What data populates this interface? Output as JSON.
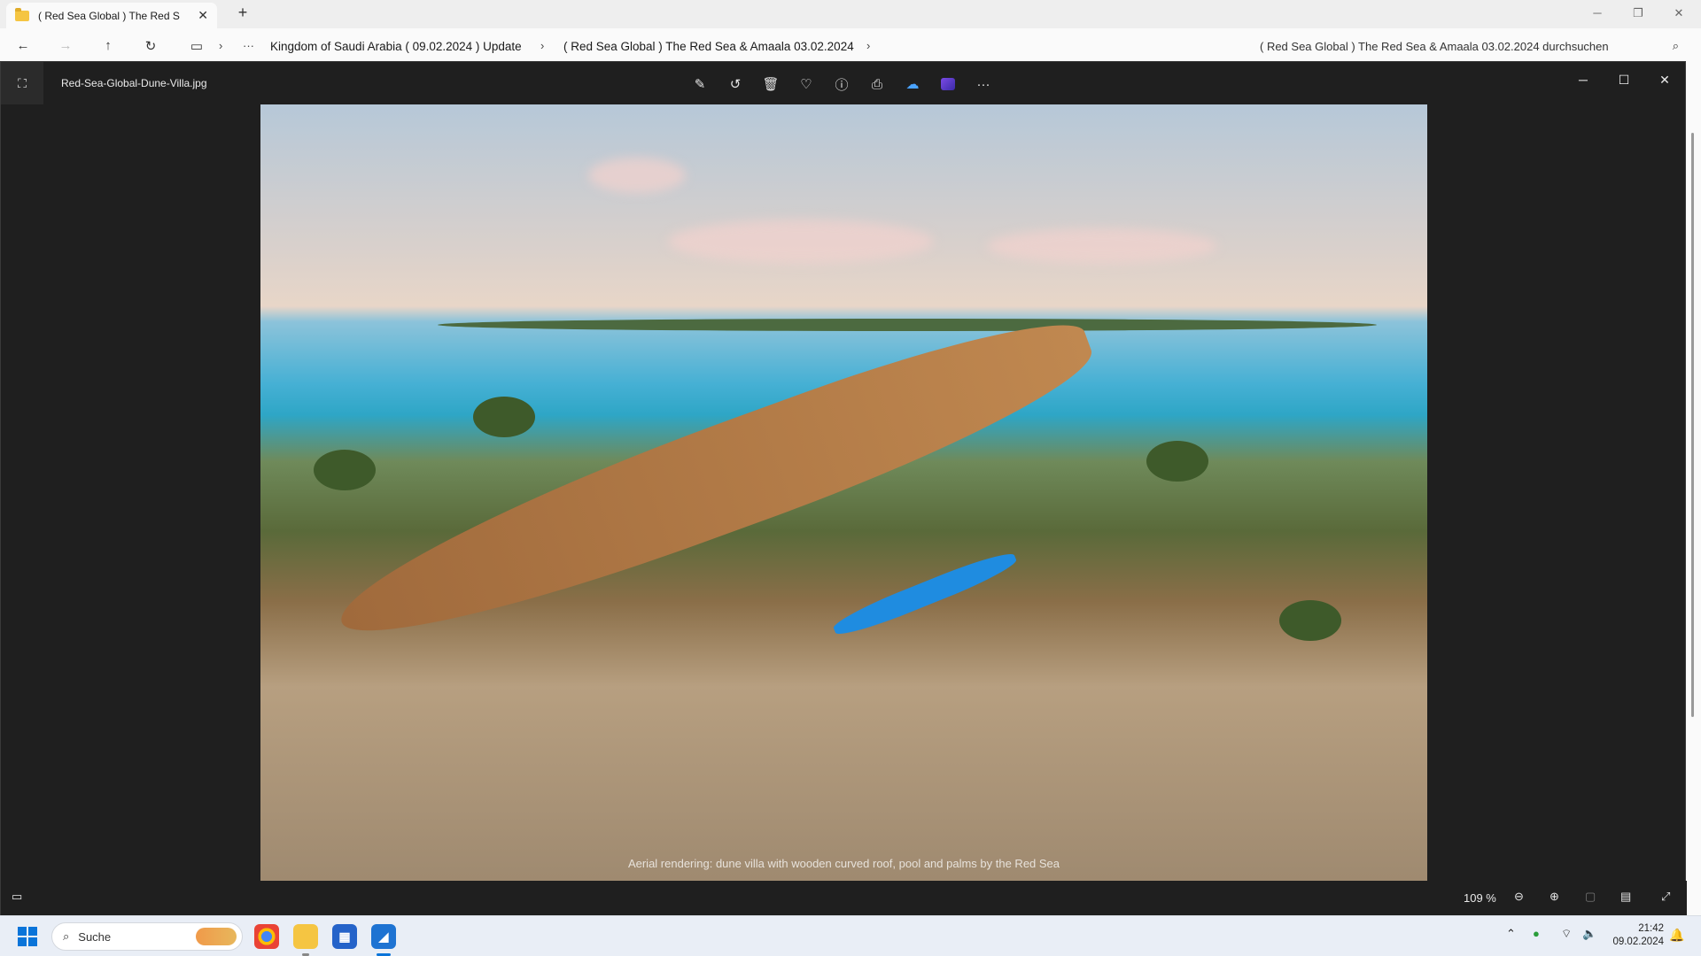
{
  "explorer": {
    "tab_title": "( Red Sea Global ) The Red Sea",
    "new_tab_icon": "plus-icon",
    "window_controls": [
      "─",
      "❐",
      "✕"
    ],
    "breadcrumbs": [
      "Kingdom of Saudi Arabia ( 09.02.2024 ) Update",
      "( Red Sea Global ) The Red Sea & Amaala 03.02.2024"
    ],
    "search_placeholder": "( Red Sea Global ) The Red Sea & Amaala 03.02.2024 durchsuchen"
  },
  "viewer": {
    "filename": "Red-Sea-Global-Dune-Villa.jpg",
    "toolbar": [
      "edit-icon",
      "rotate-icon",
      "delete-icon",
      "favorite-icon",
      "info-icon",
      "print-icon",
      "onedrive-icon",
      "clipchamp-icon",
      "more-icon"
    ],
    "window_controls": [
      "─",
      "☐",
      "✕"
    ],
    "zoom": "109 %",
    "image_label": "Aerial rendering: dune villa with wooden curved roof, pool and palms by the Red Sea"
  },
  "taskbar": {
    "search_label": "Suche",
    "time": "21:42",
    "date": "09.02.2024"
  }
}
